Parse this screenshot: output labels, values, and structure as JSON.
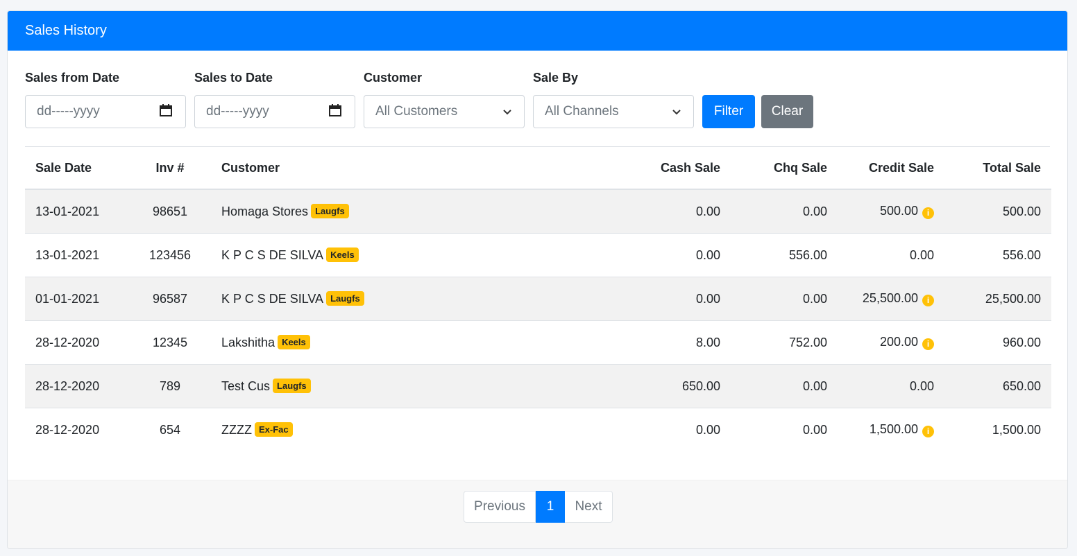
{
  "header": {
    "title": "Sales History"
  },
  "filters": {
    "from_label": "Sales from Date",
    "from_placeholder": "dd-----yyyy",
    "to_label": "Sales to Date",
    "to_placeholder": "dd-----yyyy",
    "customer_label": "Customer",
    "customer_value": "All Customers",
    "saleby_label": "Sale By",
    "saleby_value": "All Channels",
    "filter_button": "Filter",
    "clear_button": "Clear"
  },
  "table": {
    "columns": [
      "Sale Date",
      "Inv #",
      "Customer",
      "Cash Sale",
      "Chq Sale",
      "Credit Sale",
      "Total Sale"
    ],
    "rows": [
      {
        "date": "13-01-2021",
        "inv": "98651",
        "customer": "Homaga Stores",
        "channel": "Laugfs",
        "cash": "0.00",
        "chq": "0.00",
        "credit": "500.00",
        "credit_info": true,
        "total": "500.00"
      },
      {
        "date": "13-01-2021",
        "inv": "123456",
        "customer": "K P C S DE SILVA",
        "channel": "Keels",
        "cash": "0.00",
        "chq": "556.00",
        "credit": "0.00",
        "credit_info": false,
        "total": "556.00"
      },
      {
        "date": "01-01-2021",
        "inv": "96587",
        "customer": "K P C S DE SILVA",
        "channel": "Laugfs",
        "cash": "0.00",
        "chq": "0.00",
        "credit": "25,500.00",
        "credit_info": true,
        "total": "25,500.00"
      },
      {
        "date": "28-12-2020",
        "inv": "12345",
        "customer": "Lakshitha",
        "channel": "Keels",
        "cash": "8.00",
        "chq": "752.00",
        "credit": "200.00",
        "credit_info": true,
        "total": "960.00"
      },
      {
        "date": "28-12-2020",
        "inv": "789",
        "customer": "Test Cus",
        "channel": "Laugfs",
        "cash": "650.00",
        "chq": "0.00",
        "credit": "0.00",
        "credit_info": false,
        "total": "650.00"
      },
      {
        "date": "28-12-2020",
        "inv": "654",
        "customer": "ZZZZ",
        "channel": "Ex-Fac",
        "cash": "0.00",
        "chq": "0.00",
        "credit": "1,500.00",
        "credit_info": true,
        "total": "1,500.00"
      }
    ]
  },
  "pagination": {
    "previous": "Previous",
    "current": "1",
    "next": "Next"
  },
  "colors": {
    "primary": "#007bff",
    "secondary": "#6c757d",
    "badge": "#ffc107"
  },
  "icons": {
    "date": "calendar-icon",
    "select": "chevron-down-icon",
    "info": "info-icon"
  }
}
